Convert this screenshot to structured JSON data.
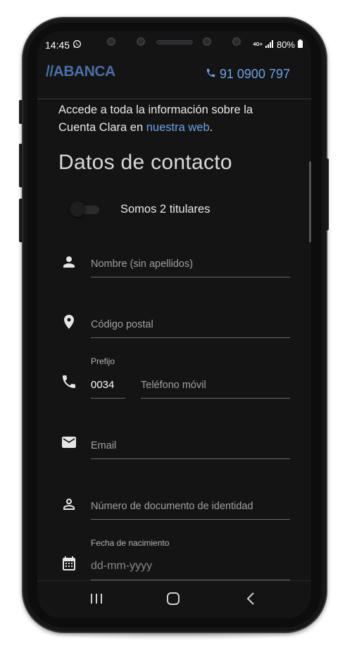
{
  "status_bar": {
    "time": "14:45",
    "network": "4G+",
    "battery": "80%"
  },
  "header": {
    "logo": "//ABANCA",
    "phone": "91 0900 797"
  },
  "intro": {
    "text_before": "Accede a toda la información sobre la Cuenta Clara en ",
    "link": "nuestra web",
    "text_after": "."
  },
  "form": {
    "title": "Datos de contacto",
    "toggle_label": "Somos 2 titulares",
    "name_placeholder": "Nombre (sin apellidos)",
    "postal_placeholder": "Código postal",
    "prefix_label": "Prefijo",
    "prefix_value": "0034",
    "phone_placeholder": "Teléfono móvil",
    "email_placeholder": "Email",
    "id_placeholder": "Número de documento de identidad",
    "birth_label": "Fecha de nacimiento",
    "birth_placeholder": "dd-mm-yyyy"
  },
  "colors": {
    "accent": "#6ea2e6",
    "logo": "#4b6fa8",
    "background": "#141414"
  },
  "icons": [
    "whatsapp-icon",
    "signal-icon",
    "battery-icon",
    "phone-icon",
    "person-icon",
    "location-icon",
    "phone-icon",
    "mail-icon",
    "id-person-icon",
    "calendar-icon",
    "recents-icon",
    "home-icon",
    "back-icon"
  ]
}
